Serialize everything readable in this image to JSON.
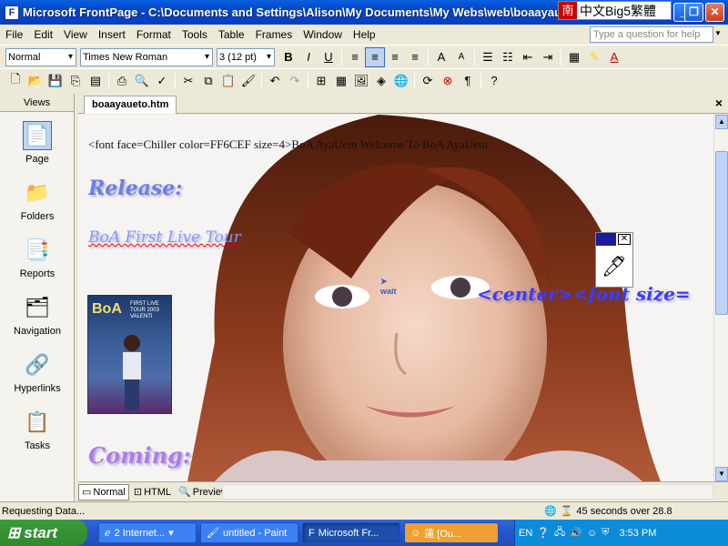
{
  "window": {
    "title": "Microsoft FrontPage - C:\\Documents and Settings\\Alison\\My Documents\\My Webs\\web\\boaayaueto.htm",
    "ime_text": "中文Big5繁體",
    "ime_logo": "南"
  },
  "menu": {
    "items": [
      "File",
      "Edit",
      "View",
      "Insert",
      "Format",
      "Tools",
      "Table",
      "Frames",
      "Window",
      "Help"
    ],
    "help_placeholder": "Type a question for help"
  },
  "format_toolbar": {
    "style": "Normal",
    "font": "Times New Roman",
    "size": "3 (12 pt)"
  },
  "views": {
    "header": "Views",
    "items": [
      "Page",
      "Folders",
      "Reports",
      "Navigation",
      "Hyperlinks",
      "Tasks"
    ]
  },
  "document": {
    "tab": "boaayaueto.htm",
    "raw_text": "<font face=Chiller color=FF6CEF size=4>BoA AyaUeto Welcome To BoA AyaUeto",
    "release": "Release:",
    "first_live": "BoA First Live Tour",
    "center_tag": "<center><font size=",
    "coming": "Coming:",
    "poster": {
      "title": "BoA",
      "subtitle": "FIRST LIVE TOUR 2003 VALENTI"
    },
    "cursor_label": "wait"
  },
  "view_tabs": [
    "Normal",
    "HTML",
    "Preview"
  ],
  "status": {
    "left": "Requesting Data...",
    "right": "45 seconds over 28.8"
  },
  "taskbar": {
    "start": "start",
    "tasks": [
      "2 Internet...",
      "untitled - Paint",
      "Microsoft Fr...",
      "蓮 [Ou..."
    ],
    "lang": "EN",
    "time": "3:53 PM"
  }
}
